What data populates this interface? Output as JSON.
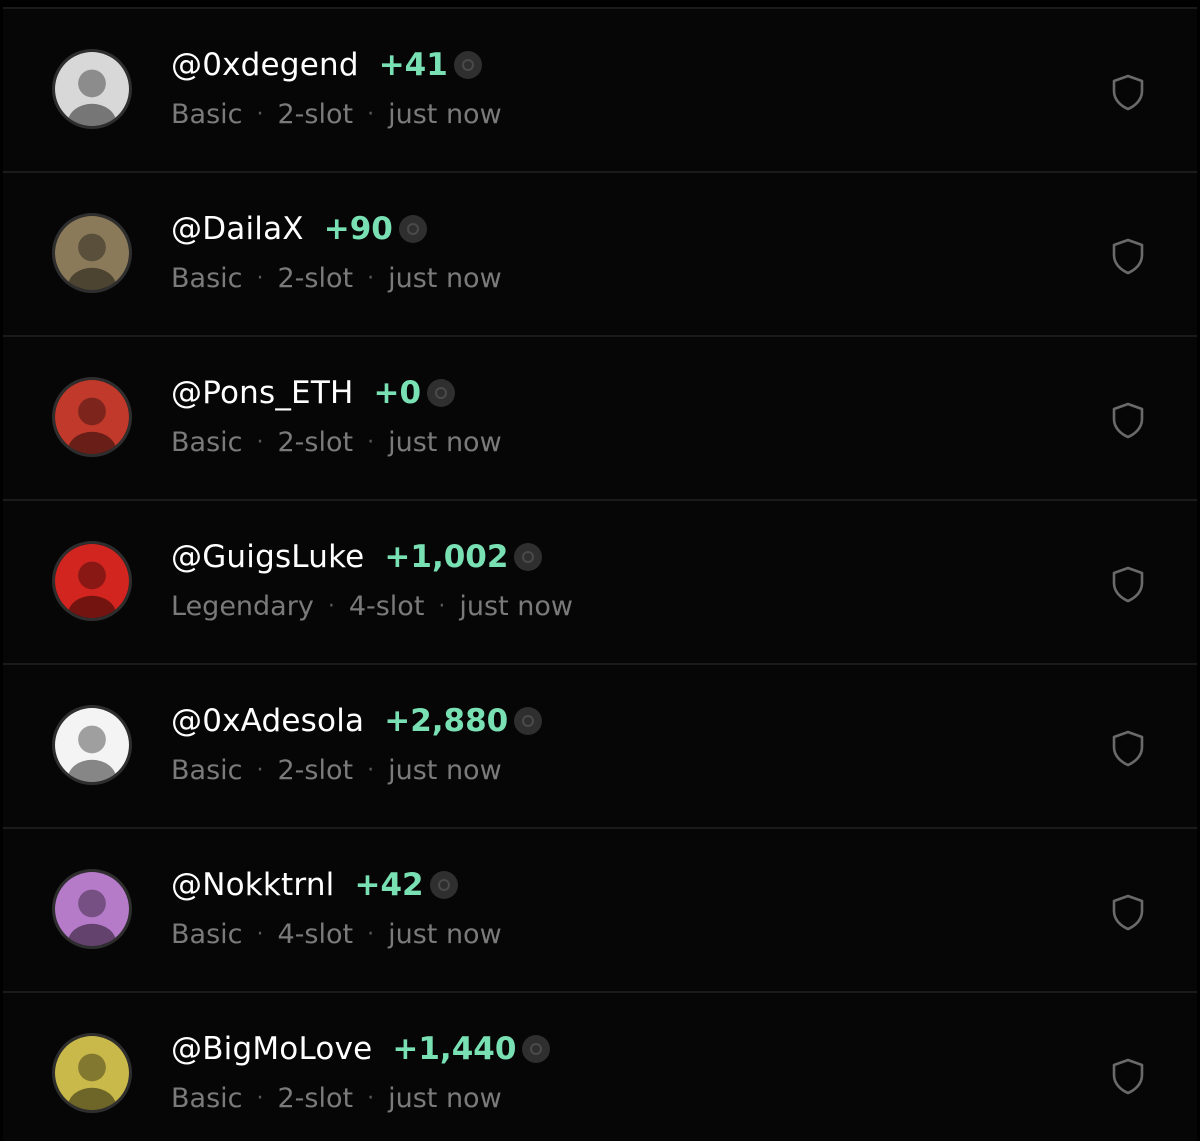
{
  "rows": [
    {
      "handle": "@0xdegend",
      "points": "+41",
      "tier": "Basic",
      "slots": "2-slot",
      "time": "just now",
      "avatar_color": "#d8d8d8"
    },
    {
      "handle": "@DailaX",
      "points": "+90",
      "tier": "Basic",
      "slots": "2-slot",
      "time": "just now",
      "avatar_color": "#8a7a5a"
    },
    {
      "handle": "@Pons_ETH",
      "points": "+0",
      "tier": "Basic",
      "slots": "2-slot",
      "time": "just now",
      "avatar_color": "#c0392b"
    },
    {
      "handle": "@GuigsLuke",
      "points": "+1,002",
      "tier": "Legendary",
      "slots": "4-slot",
      "time": "just now",
      "avatar_color": "#d3251f"
    },
    {
      "handle": "@0xAdesola",
      "points": "+2,880",
      "tier": "Basic",
      "slots": "2-slot",
      "time": "just now",
      "avatar_color": "#f4f4f4"
    },
    {
      "handle": "@Nokktrnl",
      "points": "+42",
      "tier": "Basic",
      "slots": "4-slot",
      "time": "just now",
      "avatar_color": "#b57bc9"
    },
    {
      "handle": "@BigMoLove",
      "points": "+1,440",
      "tier": "Basic",
      "slots": "2-slot",
      "time": "just now",
      "avatar_color": "#c9b94a"
    }
  ],
  "colors": {
    "background": "#000000",
    "row_background": "#060606",
    "divider": "#1b1b1b",
    "handle": "#ffffff",
    "points": "#79e0b4",
    "meta": "#7a7a7a",
    "shield": "#6a6a6a"
  },
  "icons": {
    "coin": "coin-icon",
    "shield": "shield-icon"
  }
}
